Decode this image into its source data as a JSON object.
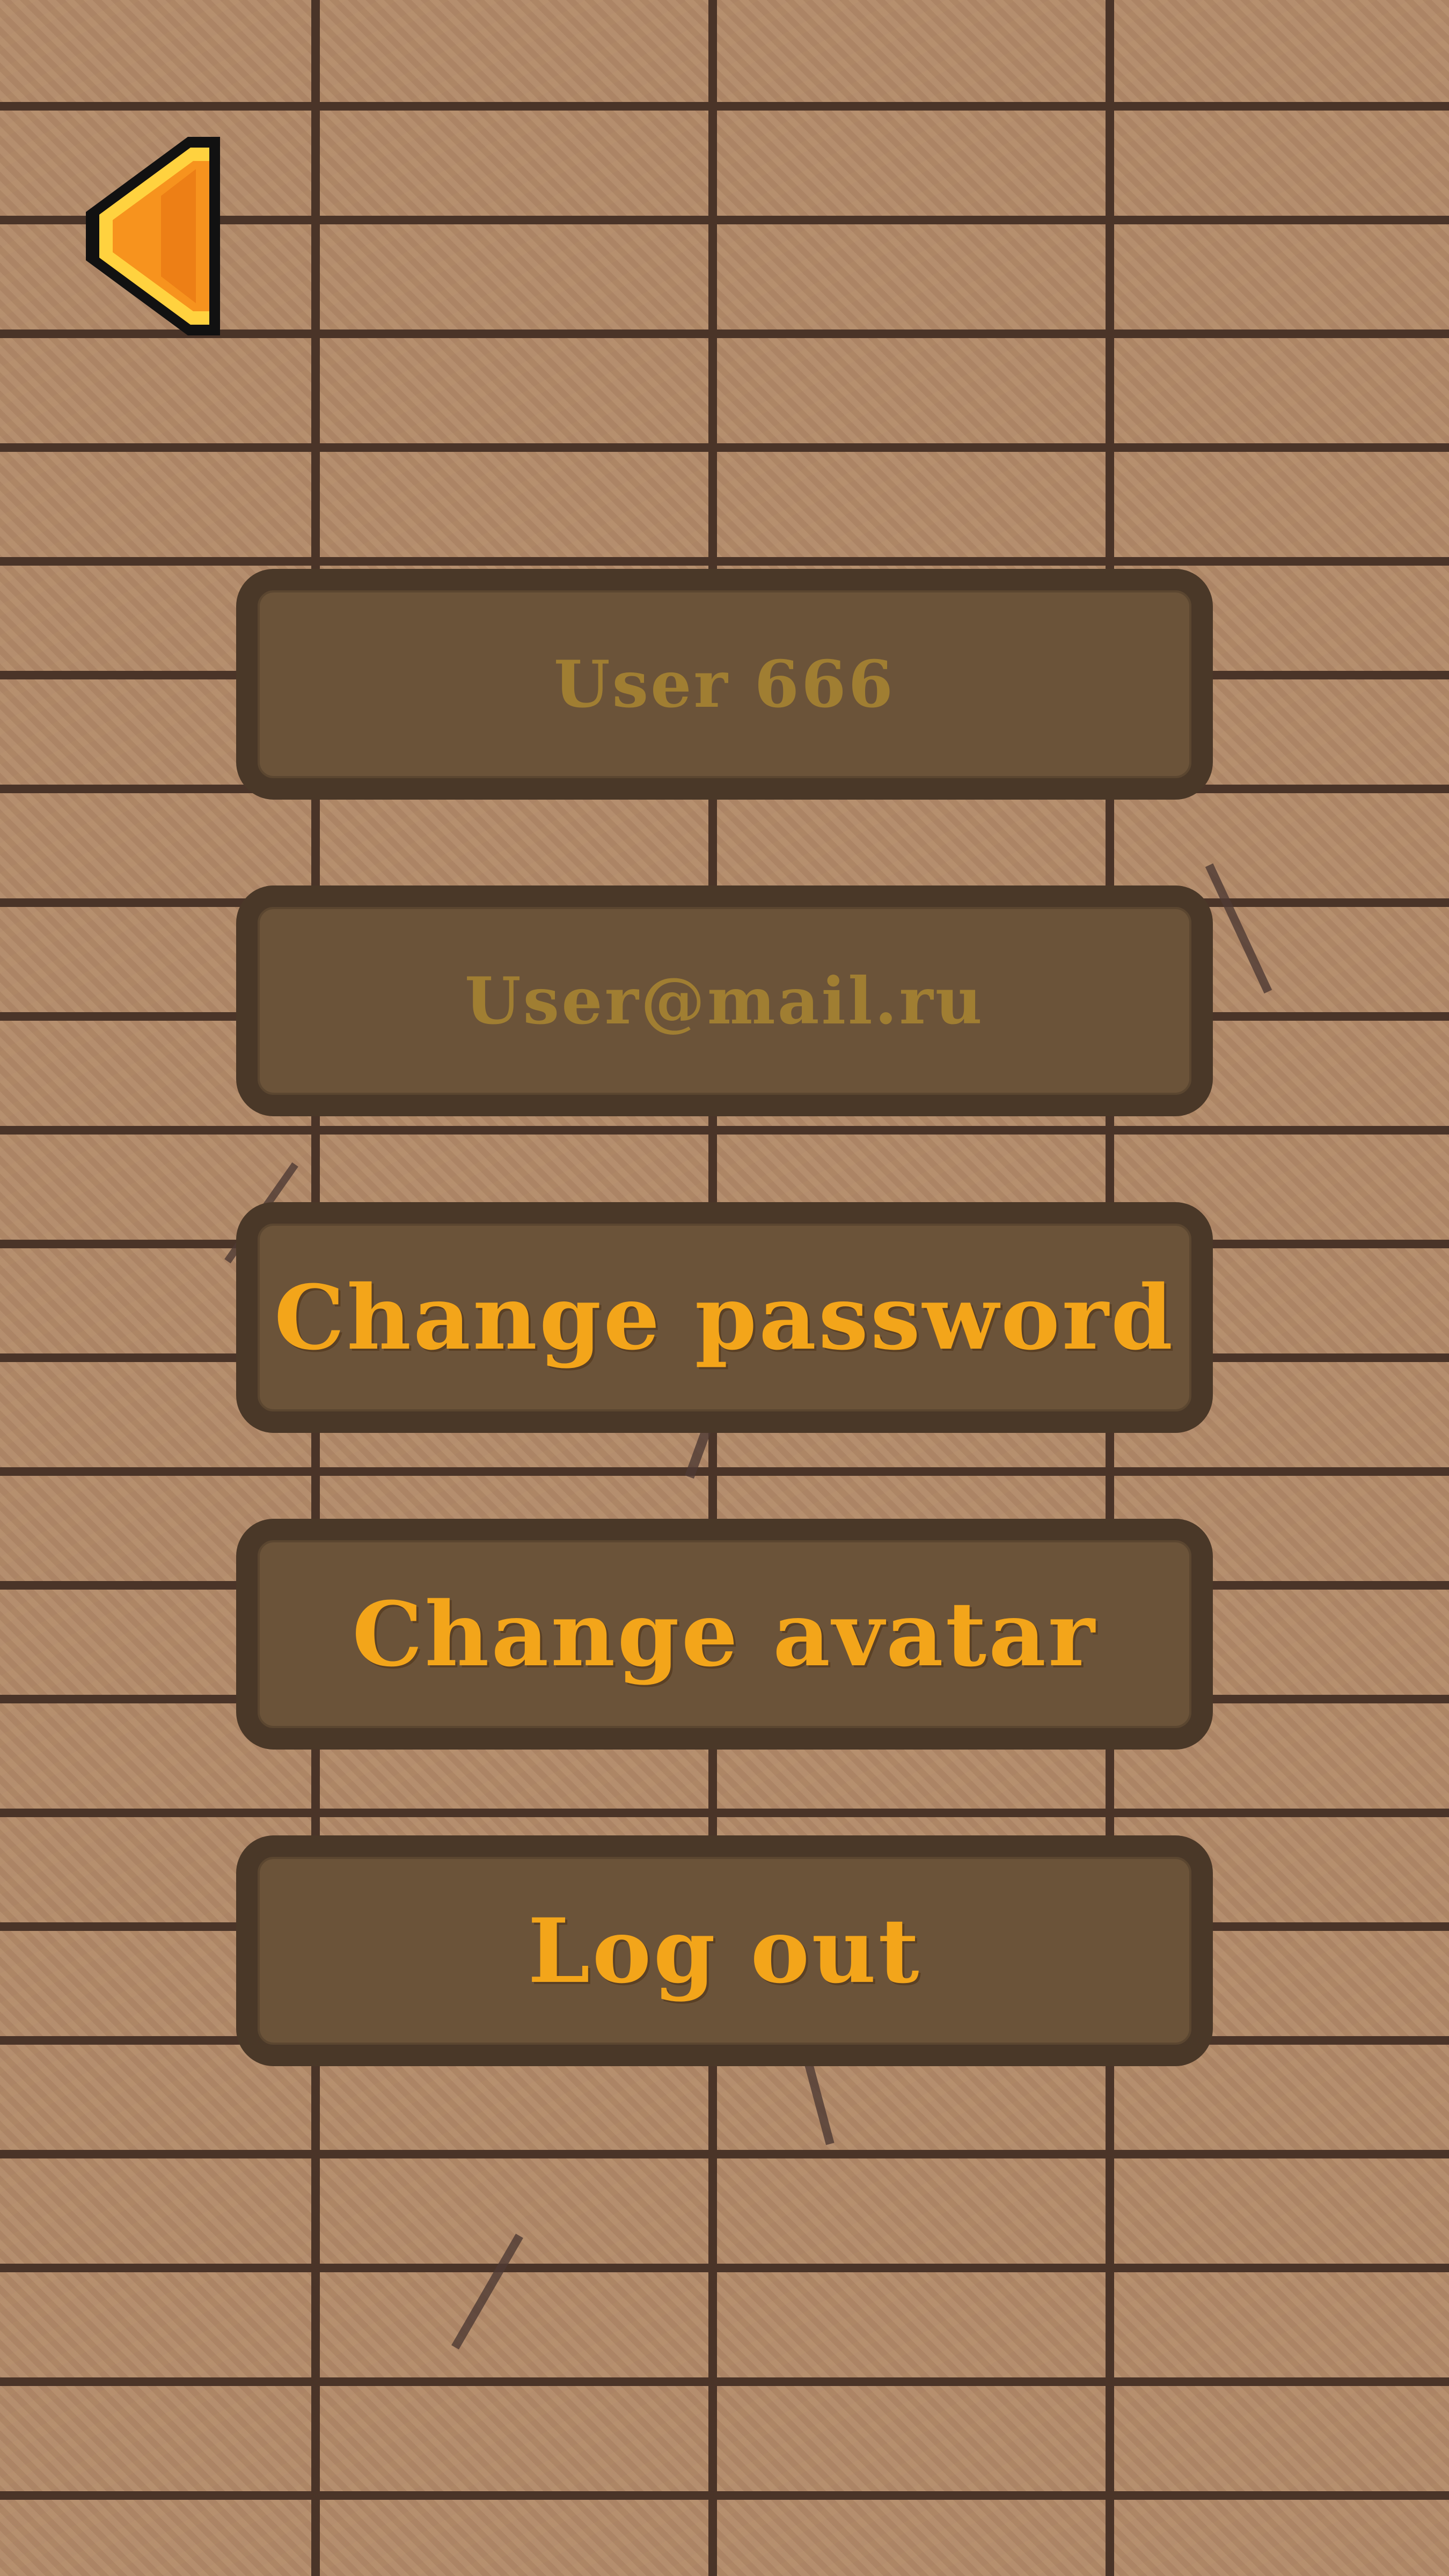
{
  "profile": {
    "username": "User 666",
    "email": "User@mail.ru"
  },
  "actions": {
    "change_password": "Change password",
    "change_avatar": "Change avatar",
    "log_out": "Log out"
  },
  "icons": {
    "back": "back-arrow-icon"
  },
  "colors": {
    "field_text": "#a07e32",
    "action_text": "#f3a51a",
    "panel_fill": "#6b5339",
    "panel_border": "#4a3828",
    "arrow_fill": "#f7931e",
    "arrow_highlight": "#ffd23f"
  }
}
